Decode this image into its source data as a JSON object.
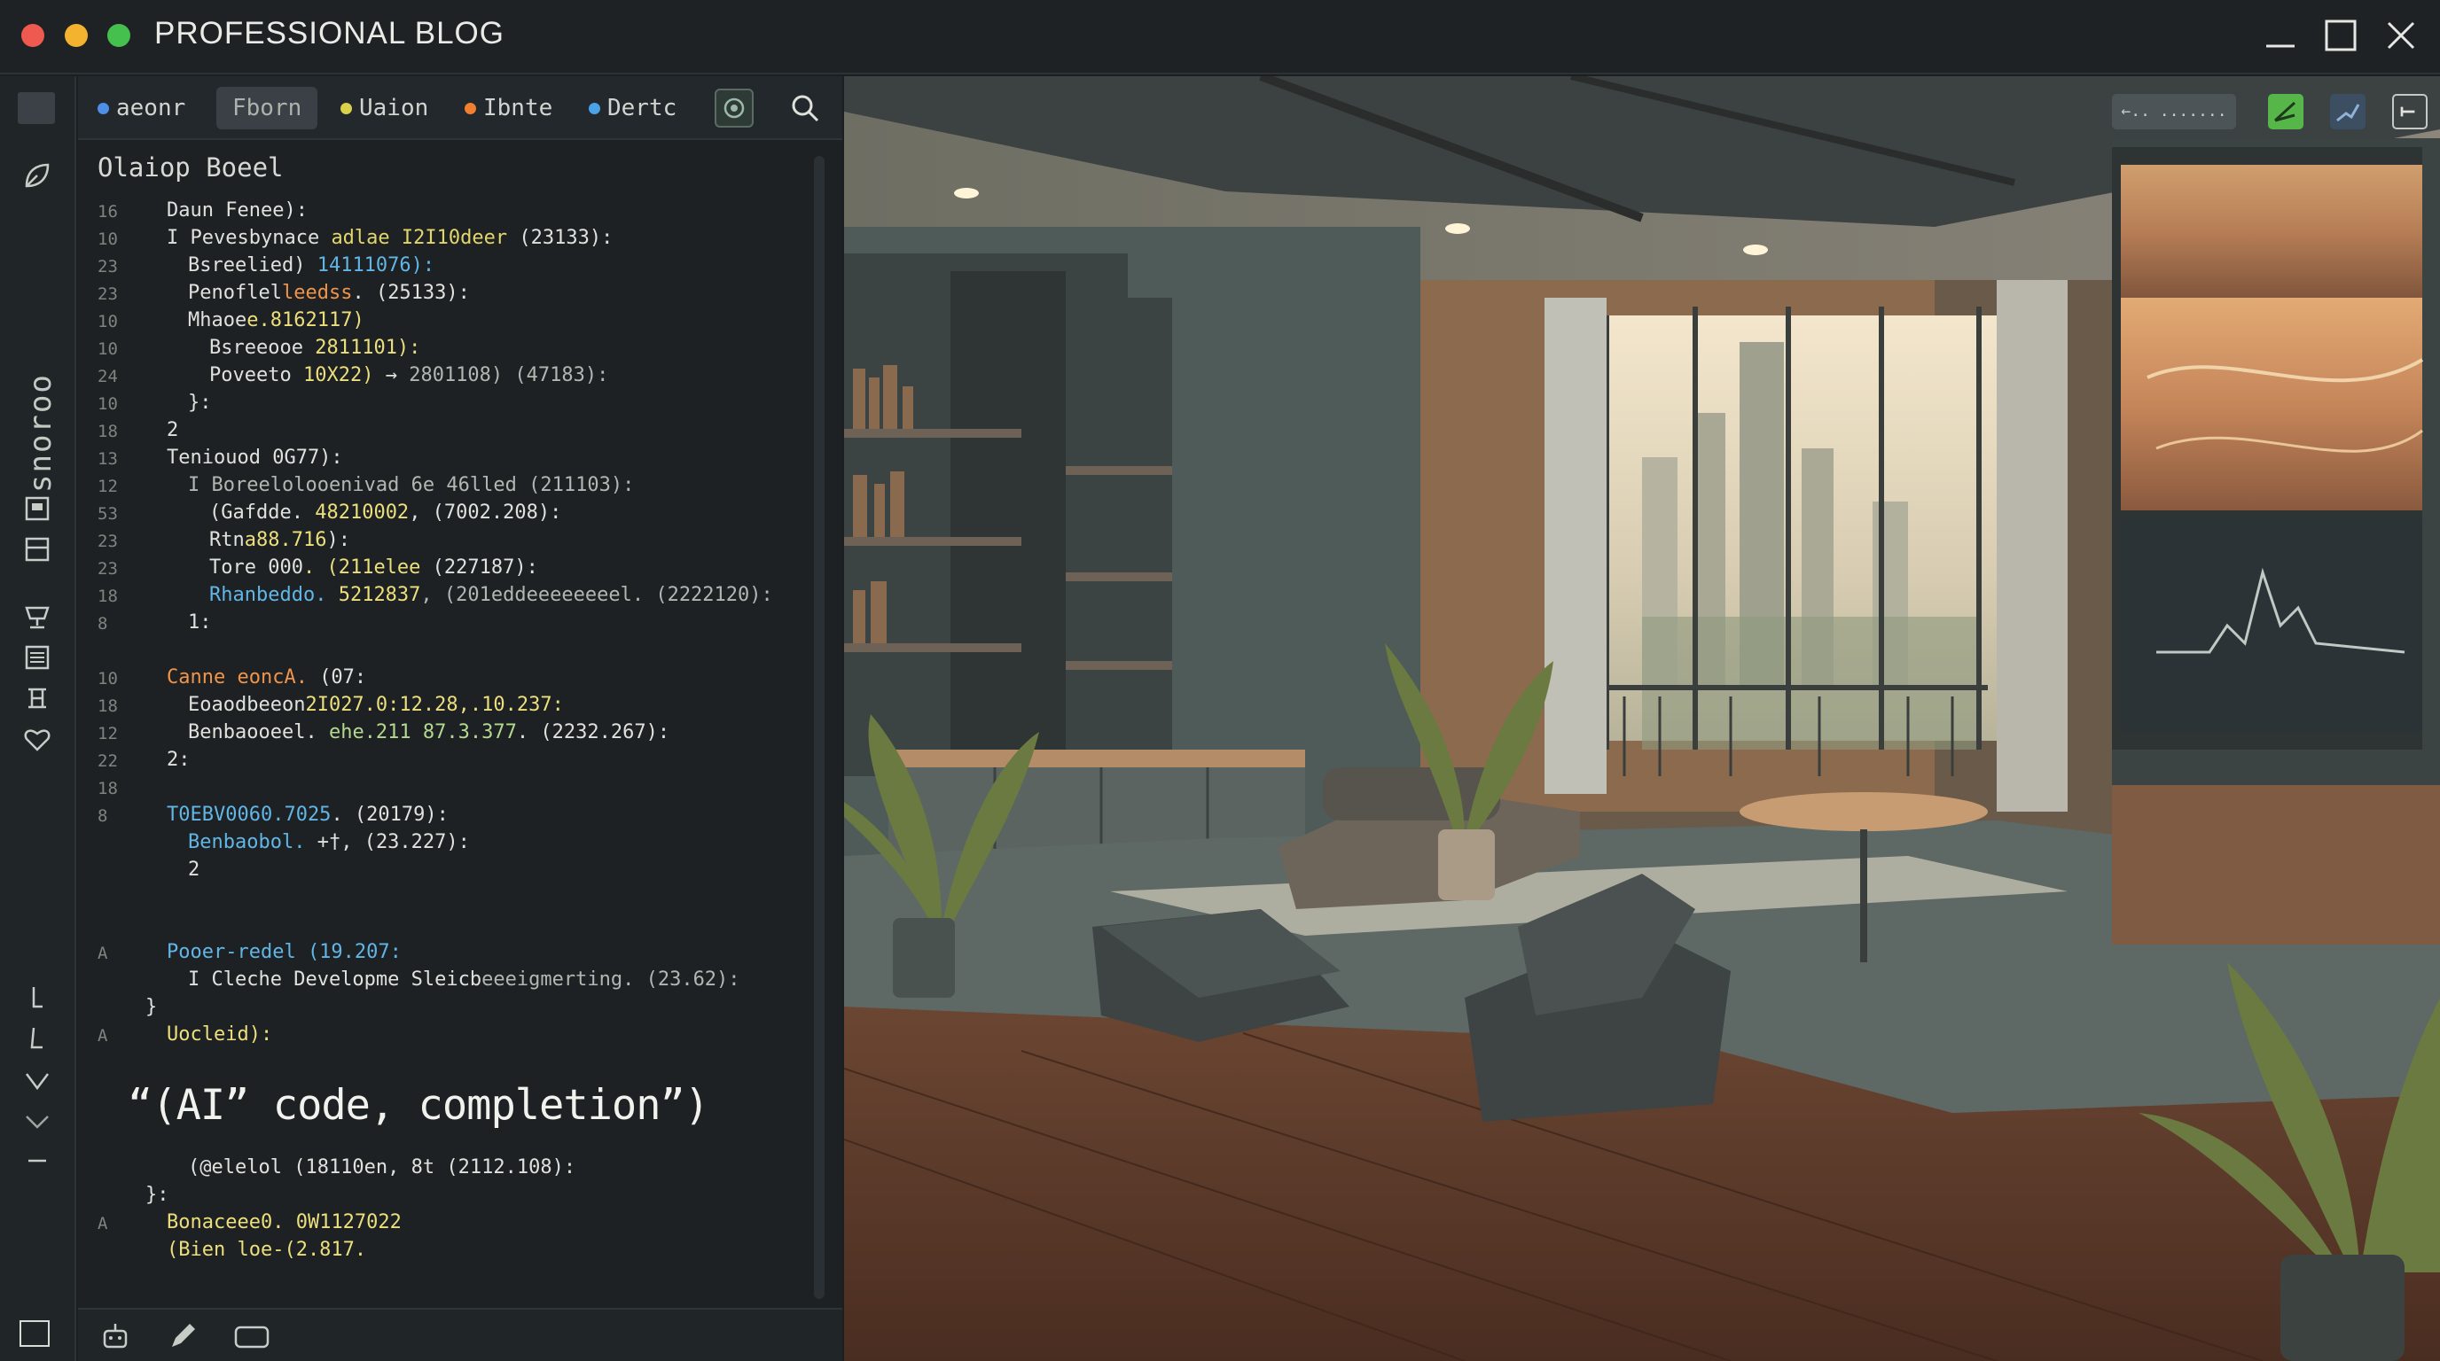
{
  "window": {
    "title": "PROFESSIONAL BLOG",
    "controls": [
      "minimize-icon",
      "maximize-icon",
      "close-icon"
    ]
  },
  "rail": {
    "vertical_label": "snoroo",
    "icons": [
      "leaf-icon",
      "panel-icon",
      "layers-icon",
      "trophy-icon",
      "list-icon",
      "stack-icon",
      "heart-icon",
      "arrow-down-icon",
      "arrow-left-icon",
      "chevron-down-icon",
      "chevron-down-icon",
      "dash-icon",
      "square-icon"
    ]
  },
  "editor": {
    "tabs": [
      {
        "label": "aeonr",
        "dot": "#4f8fe6"
      },
      {
        "label": "Fborn",
        "active": true
      },
      {
        "label": "Uaion",
        "dot": "#d9d24a"
      },
      {
        "label": "Ibnte",
        "dot": "#f07f30"
      },
      {
        "label": "Dertc",
        "dot": "#4aa3e6"
      }
    ],
    "heading": "Olaiop Boeel",
    "lines": [
      {
        "n": "16",
        "indent": 1,
        "parts": [
          {
            "t": "Daun Fenee):",
            "c": "white"
          }
        ]
      },
      {
        "n": "10",
        "indent": 1,
        "parts": [
          {
            "t": "I Pevesbynace ",
            "c": "white"
          },
          {
            "t": "adlae I2I10deer",
            "c": "yellow"
          },
          {
            "t": " (23133):",
            "c": "white"
          }
        ]
      },
      {
        "n": "23",
        "indent": 2,
        "parts": [
          {
            "t": "Bsreelied) ",
            "c": "white"
          },
          {
            "t": "14111076):",
            "c": "blue"
          }
        ]
      },
      {
        "n": "23",
        "indent": 2,
        "parts": [
          {
            "t": "Penoflel",
            "c": "white"
          },
          {
            "t": "leedss",
            "c": "orange"
          },
          {
            "t": ". (25133):",
            "c": "white"
          }
        ]
      },
      {
        "n": "10",
        "indent": 2,
        "parts": [
          {
            "t": "Mhaoe",
            "c": "white"
          },
          {
            "t": "e.8162117)",
            "c": "lemon"
          }
        ]
      },
      {
        "n": "10",
        "indent": 3,
        "parts": [
          {
            "t": "Bsreeooe ",
            "c": "white"
          },
          {
            "t": "2811101):",
            "c": "lemon"
          }
        ]
      },
      {
        "n": "24",
        "indent": 3,
        "parts": [
          {
            "t": "Poveeto ",
            "c": "white"
          },
          {
            "t": "10X22)",
            "c": "lemon"
          },
          {
            "t": " → ",
            "c": "white"
          },
          {
            "t": "2801108) (47183):",
            "c": "grey"
          }
        ]
      },
      {
        "n": "10",
        "indent": 2,
        "parts": [
          {
            "t": "}:",
            "c": "white"
          }
        ]
      },
      {
        "n": "18",
        "indent": 1,
        "parts": [
          {
            "t": "2",
            "c": "white"
          }
        ]
      },
      {
        "n": "13",
        "indent": 1,
        "parts": [
          {
            "t": "Teniouod 0G77):",
            "c": "white"
          }
        ]
      },
      {
        "n": "12",
        "indent": 2,
        "parts": [
          {
            "t": "I Boreelolooenivad 6e 46lled (211103):",
            "c": "grey"
          }
        ]
      },
      {
        "n": "53",
        "indent": 3,
        "parts": [
          {
            "t": "(Gafdde. ",
            "c": "white"
          },
          {
            "t": "48210002",
            "c": "lemon"
          },
          {
            "t": ", (7002.208):",
            "c": "white"
          }
        ]
      },
      {
        "n": "23",
        "indent": 3,
        "parts": [
          {
            "t": "Rtn",
            "c": "white"
          },
          {
            "t": "a88.716",
            "c": "lemon"
          },
          {
            "t": "):",
            "c": "white"
          }
        ]
      },
      {
        "n": "23",
        "indent": 3,
        "parts": [
          {
            "t": "Tore 000",
            "c": "white"
          },
          {
            "t": ". (211elee",
            "c": "lemon"
          },
          {
            "t": " (227187):",
            "c": "white"
          }
        ]
      },
      {
        "n": "18",
        "indent": 3,
        "parts": [
          {
            "t": "Rhanbeddo. ",
            "c": "blue"
          },
          {
            "t": "5212837",
            "c": "lemon"
          },
          {
            "t": ", (201eddeeeeeeeel. (2222120):",
            "c": "grey"
          }
        ]
      },
      {
        "n": "8",
        "indent": 2,
        "parts": [
          {
            "t": "1:",
            "c": "white"
          }
        ]
      },
      {
        "n": "",
        "indent": 0,
        "parts": []
      },
      {
        "n": "10",
        "indent": 1,
        "parts": [
          {
            "t": "Canne eoncA. ",
            "c": "orange"
          },
          {
            "t": "(07:",
            "c": "white"
          }
        ]
      },
      {
        "n": "18",
        "indent": 2,
        "parts": [
          {
            "t": "Eoaodbeeon",
            "c": "white"
          },
          {
            "t": "2I027.0:12.28,.10.237:",
            "c": "lemon"
          }
        ]
      },
      {
        "n": "12",
        "indent": 2,
        "parts": [
          {
            "t": "Benbaooeel. ",
            "c": "white"
          },
          {
            "t": "ehe.211 87.3.377",
            "c": "green"
          },
          {
            "t": ". (2232.267):",
            "c": "white"
          }
        ]
      },
      {
        "n": "22",
        "indent": 1,
        "parts": [
          {
            "t": "2:",
            "c": "white"
          }
        ]
      },
      {
        "n": "18",
        "indent": 0,
        "parts": []
      },
      {
        "n": "8",
        "indent": 1,
        "parts": [
          {
            "t": "T0EBV0060.7025",
            "c": "blue"
          },
          {
            "t": ". (20179):",
            "c": "white"
          }
        ]
      },
      {
        "n": "",
        "indent": 2,
        "parts": [
          {
            "t": "Benbaobol. ",
            "c": "blue"
          },
          {
            "t": "+†",
            "c": "white"
          },
          {
            "t": ", (23.227):",
            "c": "white"
          }
        ]
      },
      {
        "n": "",
        "indent": 2,
        "parts": [
          {
            "t": "2",
            "c": "white"
          }
        ]
      },
      {
        "n": "",
        "indent": 0,
        "parts": []
      },
      {
        "n": "",
        "indent": 0,
        "parts": []
      },
      {
        "n": "A",
        "indent": 1,
        "parts": [
          {
            "t": "Pooer-redel (19.207:",
            "c": "blue"
          }
        ]
      },
      {
        "n": "",
        "indent": 2,
        "parts": [
          {
            "t": "I Cleche Developme Sleicb",
            "c": "white"
          },
          {
            "t": "eeeigmerting",
            "c": "grey"
          },
          {
            "t": ". (23.62):",
            "c": "grey"
          }
        ]
      },
      {
        "n": "",
        "indent": 0,
        "parts": [
          {
            "t": "}",
            "c": "white"
          }
        ]
      },
      {
        "n": "A",
        "indent": 1,
        "parts": [
          {
            "t": "Uocleid):",
            "c": "lemon"
          }
        ]
      }
    ],
    "ai_text": "“(AI” code, completion”)",
    "lines_after": [
      {
        "n": "",
        "indent": 2,
        "parts": [
          {
            "t": "(@elelol (18110en, 8t (2112.108):",
            "c": "white"
          }
        ]
      },
      {
        "n": "",
        "indent": 0,
        "parts": [
          {
            "t": "}:",
            "c": "white"
          }
        ]
      },
      {
        "n": "A",
        "indent": 1,
        "parts": [
          {
            "t": "Bonac",
            "c": "lemon"
          },
          {
            "t": "eee0. 0W1127022",
            "c": "lemon"
          }
        ]
      },
      {
        "n": "",
        "indent": 1,
        "parts": [
          {
            "t": "(Bien loe-(2.817.",
            "c": "lemon"
          }
        ]
      }
    ]
  },
  "statusbar": {
    "icons": [
      "robot-icon",
      "pencil-icon",
      "box-icon"
    ]
  },
  "preview": {
    "toolbar": {
      "label": "←.. .......",
      "icons": [
        "chart-green-icon",
        "chart-blue-icon",
        "expand-icon"
      ]
    },
    "colors": {
      "wall": "#4b5a58",
      "floor": "#5e3b2a",
      "ceiling": "#c5b7a0",
      "accent": "#d9a46c"
    }
  }
}
